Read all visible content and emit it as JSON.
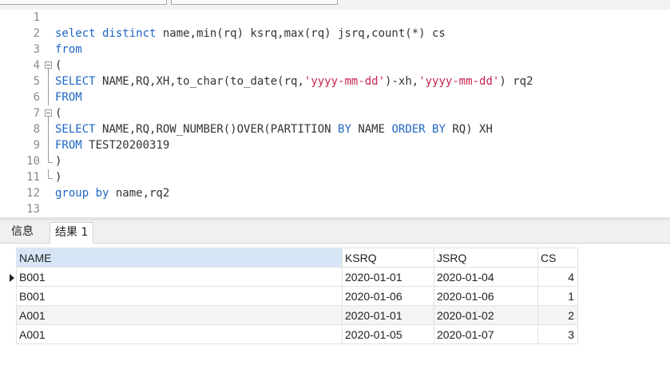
{
  "editor": {
    "lines": [
      {
        "n": "1",
        "tokens": []
      },
      {
        "n": "2",
        "tokens": [
          {
            "t": "kw",
            "v": "select distinct "
          },
          {
            "t": "p",
            "v": "name,min(rq) ksrq,max(rq) jsrq,count(*) cs"
          }
        ]
      },
      {
        "n": "3",
        "tokens": [
          {
            "t": "kw",
            "v": "from"
          }
        ]
      },
      {
        "n": "4",
        "tokens": [
          {
            "t": "p",
            "v": "("
          }
        ]
      },
      {
        "n": "5",
        "tokens": [
          {
            "t": "kw",
            "v": "SELECT "
          },
          {
            "t": "p",
            "v": "NAME,RQ,XH,to_char(to_date(rq,"
          },
          {
            "t": "str",
            "v": "'yyyy-mm-dd'"
          },
          {
            "t": "p",
            "v": ")-xh,"
          },
          {
            "t": "str",
            "v": "'yyyy-mm-dd'"
          },
          {
            "t": "p",
            "v": ") rq2"
          }
        ]
      },
      {
        "n": "6",
        "tokens": [
          {
            "t": "kw",
            "v": "FROM"
          }
        ]
      },
      {
        "n": "7",
        "tokens": [
          {
            "t": "p",
            "v": "("
          }
        ]
      },
      {
        "n": "8",
        "tokens": [
          {
            "t": "kw",
            "v": "SELECT "
          },
          {
            "t": "p",
            "v": "NAME,RQ,ROW_NUMBER()OVER(PARTITION "
          },
          {
            "t": "kw",
            "v": "BY"
          },
          {
            "t": "p",
            "v": " NAME "
          },
          {
            "t": "kw",
            "v": "ORDER BY"
          },
          {
            "t": "p",
            "v": " RQ) XH"
          }
        ]
      },
      {
        "n": "9",
        "tokens": [
          {
            "t": "kw",
            "v": "FROM "
          },
          {
            "t": "p",
            "v": "TEST20200319"
          }
        ]
      },
      {
        "n": "10",
        "tokens": [
          {
            "t": "p",
            "v": ")"
          }
        ]
      },
      {
        "n": "11",
        "tokens": [
          {
            "t": "p",
            "v": ")"
          }
        ]
      },
      {
        "n": "12",
        "tokens": [
          {
            "t": "kw",
            "v": "group by "
          },
          {
            "t": "p",
            "v": "name,rq2"
          }
        ]
      },
      {
        "n": "13",
        "tokens": []
      }
    ]
  },
  "tabs": {
    "info": "信息",
    "result": "结果 1"
  },
  "grid": {
    "columns": [
      "NAME",
      "KSRQ",
      "JSRQ",
      "CS"
    ],
    "rows": [
      [
        "B001",
        "2020-01-01",
        "2020-01-04",
        "4"
      ],
      [
        "B001",
        "2020-01-06",
        "2020-01-06",
        "1"
      ],
      [
        "A001",
        "2020-01-01",
        "2020-01-02",
        "2"
      ],
      [
        "A001",
        "2020-01-05",
        "2020-01-07",
        "3"
      ]
    ]
  }
}
